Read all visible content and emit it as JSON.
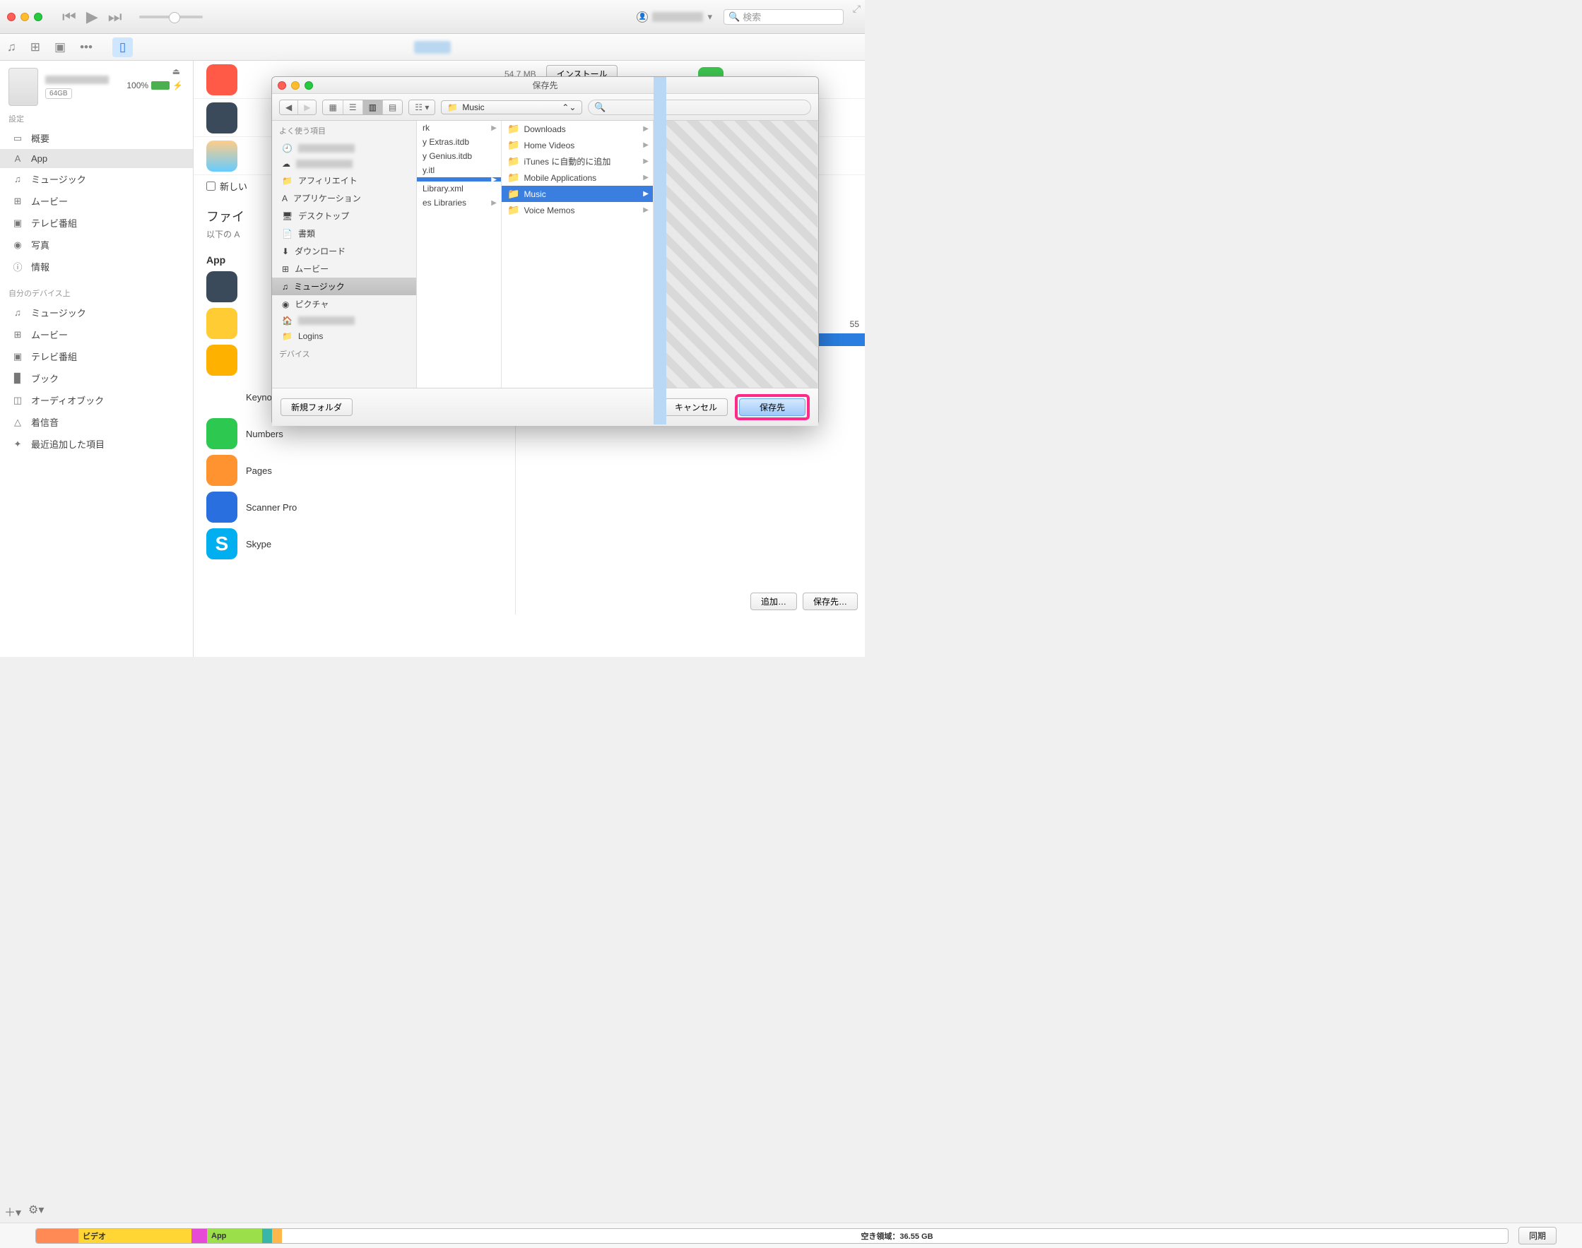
{
  "titlebar": {
    "search_placeholder": "検索"
  },
  "device": {
    "capacity": "64GB",
    "battery": "100%"
  },
  "sidebar": {
    "section_settings": "設定",
    "items": [
      {
        "icon": "▭",
        "label": "概要"
      },
      {
        "icon": "A",
        "label": "App"
      },
      {
        "icon": "♫",
        "label": "ミュージック"
      },
      {
        "icon": "⊞",
        "label": "ムービー"
      },
      {
        "icon": "▣",
        "label": "テレビ番組"
      },
      {
        "icon": "◉",
        "label": "写真"
      },
      {
        "icon": "ⓘ",
        "label": "情報"
      }
    ],
    "section_device": "自分のデバイス上",
    "device_items": [
      {
        "icon": "♫",
        "label": "ミュージック"
      },
      {
        "icon": "⊞",
        "label": "ムービー"
      },
      {
        "icon": "▣",
        "label": "テレビ番組"
      },
      {
        "icon": "▉",
        "label": "ブック"
      },
      {
        "icon": "◫",
        "label": "オーディオブック"
      },
      {
        "icon": "△",
        "label": "着信音"
      },
      {
        "icon": "✦",
        "label": "最近追加した項目"
      }
    ]
  },
  "main": {
    "top_size": "54.7 MB",
    "install_btn": "インストール",
    "new_checkbox": "新しい",
    "section_file": "ファイ",
    "section_sub": "以下の A",
    "app_heading": "App",
    "apps": [
      {
        "name": "Keynote",
        "color": "#1e9bf0"
      },
      {
        "name": "Numbers",
        "color": "#2cc850"
      },
      {
        "name": "Pages",
        "color": "#ff9330"
      },
      {
        "name": "Scanner Pro",
        "color": "#2a6fe0"
      },
      {
        "name": "Skype",
        "color": "#00aff0"
      }
    ],
    "add_btn": "追加…",
    "saveto_btn": "保存先…",
    "badge55": "55"
  },
  "dialog": {
    "title": "保存先",
    "path_label": "Music",
    "sidebar_label": "よく使う項目",
    "sidebar_devices": "デバイス",
    "side_items": [
      {
        "icon": "📁",
        "label": "アフィリエイト"
      },
      {
        "icon": "A",
        "label": "アプリケーション"
      },
      {
        "icon": "🖥",
        "label": "デスクトップ"
      },
      {
        "icon": "📄",
        "label": "書類"
      },
      {
        "icon": "⬇",
        "label": "ダウンロード"
      },
      {
        "icon": "⊞",
        "label": "ムービー"
      },
      {
        "icon": "♫",
        "label": "ミュージック",
        "sel": true
      },
      {
        "icon": "◉",
        "label": "ピクチャ"
      },
      {
        "icon": "📁",
        "label": "Logins"
      }
    ],
    "col1": [
      {
        "label": "rk"
      },
      {
        "label": "y Extras.itdb"
      },
      {
        "label": "y Genius.itdb"
      },
      {
        "label": "y.itl"
      },
      {
        "label": "",
        "sel": true
      },
      {
        "label": "Library.xml"
      },
      {
        "label": "es Libraries"
      }
    ],
    "col2": [
      {
        "label": "Downloads"
      },
      {
        "label": "Home Videos"
      },
      {
        "label": "iTunes に自動的に追加"
      },
      {
        "label": "Mobile Applications"
      },
      {
        "label": "Music",
        "sel": true
      },
      {
        "label": "Voice Memos"
      }
    ],
    "new_folder": "新規フォルダ",
    "cancel": "キャンセル",
    "save": "保存先"
  },
  "storage": {
    "video": "ビデオ",
    "app": "App",
    "free": "空き領域：36.55 GB",
    "sync": "同期"
  }
}
